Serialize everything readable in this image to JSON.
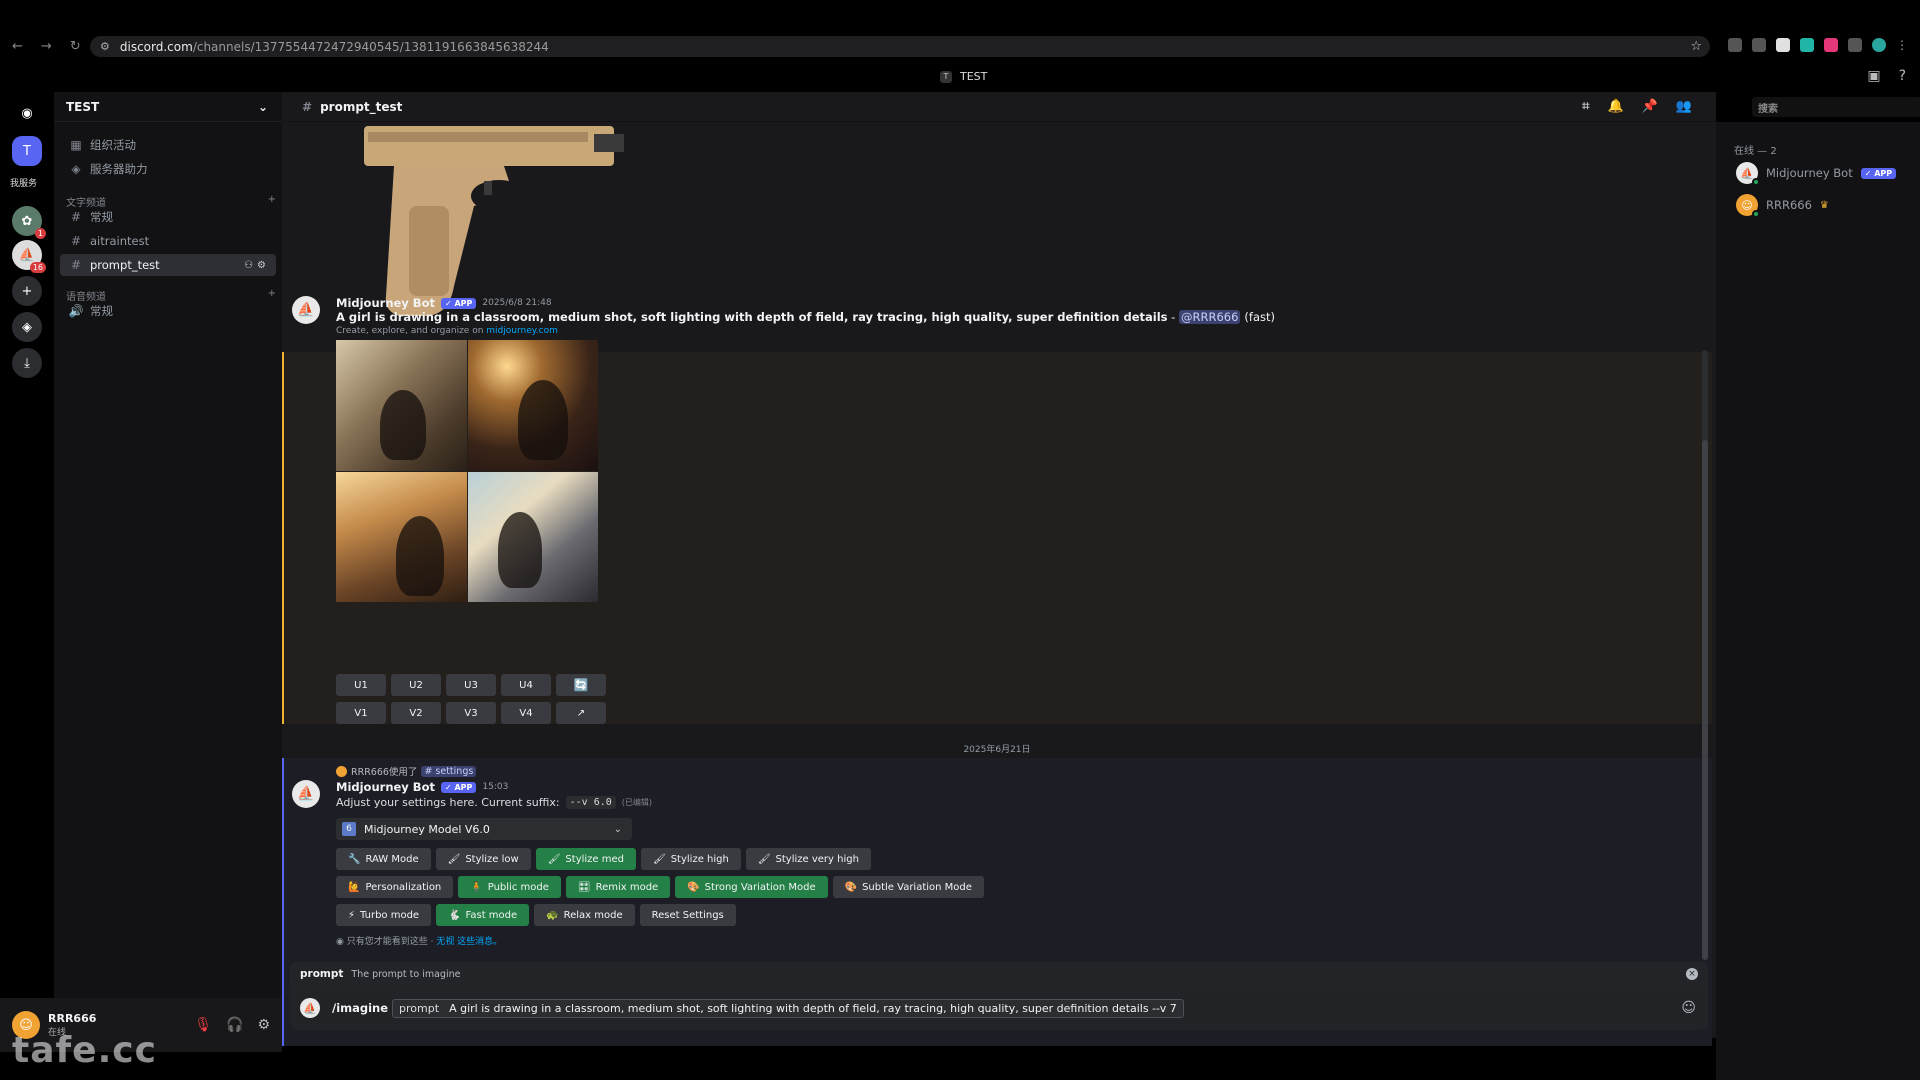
{
  "browser": {
    "url_host": "discord.com",
    "url_path": "/channels/1377554472472940545/1381191663845638244"
  },
  "window": {
    "guild_title": "TEST"
  },
  "rail": {
    "server_initial": "T",
    "label": "我服务",
    "badges": [
      "1",
      "16"
    ]
  },
  "guild": {
    "name": "TEST",
    "top_items": [
      {
        "label": "组织活动",
        "icon": "calendar-icon"
      },
      {
        "label": "服务器助力",
        "icon": "boost-icon"
      }
    ],
    "text_category": "文字频道",
    "text_channels": [
      "常规",
      "aitraintest",
      "prompt_test"
    ],
    "voice_category": "语音频道",
    "voice_channels": [
      "常规"
    ]
  },
  "user": {
    "name": "RRR666",
    "status": "在线"
  },
  "watermark": "tafe.cc",
  "chat": {
    "channel": "prompt_test",
    "search_placeholder": "搜索",
    "msg1": {
      "author": "Midjourney Bot",
      "badge": "✓ APP",
      "time": "2025/6/8 21:48",
      "prompt": "A girl is drawing in a classroom, medium shot, soft lighting with depth of field, ray tracing, high quality, super definition details",
      "dash": " - ",
      "mention": "@RRR666",
      "speed": "(fast)",
      "sub_text": "Create, explore, and organize on ",
      "sub_link": "midjourney.com",
      "buttons_row1": [
        "U1",
        "U2",
        "U3",
        "U4"
      ],
      "buttons_row2": [
        "V1",
        "V2",
        "V3",
        "V4"
      ]
    },
    "date_divider": "2025年6月21日",
    "msg2": {
      "reply_user": "RRR666使用了",
      "reply_cmd": "# settings",
      "author": "Midjourney Bot",
      "badge": "✓ APP",
      "time": "15:03",
      "text": "Adjust your settings here. Current suffix:",
      "suffix": "--v 6.0",
      "edited": "(已编辑)",
      "select_value": "Midjourney Model V6.0",
      "select_icon_text": "6",
      "row1": [
        {
          "label": "RAW Mode",
          "on": false,
          "icon": "🔧"
        },
        {
          "label": "Stylize low",
          "on": false,
          "icon": "🖌"
        },
        {
          "label": "Stylize med",
          "on": true,
          "icon": "🖌"
        },
        {
          "label": "Stylize high",
          "on": false,
          "icon": "🖌"
        },
        {
          "label": "Stylize very high",
          "on": false,
          "icon": "🖌"
        }
      ],
      "row2": [
        {
          "label": "Personalization",
          "on": false,
          "icon": "🙋"
        },
        {
          "label": "Public mode",
          "on": true,
          "icon": "🧍"
        },
        {
          "label": "Remix mode",
          "on": true,
          "icon": "🎛"
        },
        {
          "label": "Strong Variation Mode",
          "on": true,
          "icon": "🎨"
        },
        {
          "label": "Subtle Variation Mode",
          "on": false,
          "icon": "🎨"
        }
      ],
      "row3": [
        {
          "label": "Turbo mode",
          "on": false,
          "icon": "⚡"
        },
        {
          "label": "Fast mode",
          "on": true,
          "icon": "🐇"
        },
        {
          "label": "Relax mode",
          "on": false,
          "icon": "🐢"
        },
        {
          "label": "Reset Settings",
          "on": false,
          "icon": ""
        }
      ],
      "only_you": "只有您才能看到这些 · ",
      "dismiss": "无视 这些消息。"
    },
    "command": {
      "option": "prompt",
      "option_desc": "The prompt to imagine",
      "slash": "/imagine",
      "param_key": "prompt",
      "param_value": "A girl is drawing in a classroom, medium shot, soft lighting with depth of field, ray tracing, high quality, super definition details --v 7"
    }
  },
  "members": {
    "group": "在线 — 2",
    "list": [
      {
        "name": "Midjourney Bot",
        "badge": "✓ APP"
      },
      {
        "name": "RRR666"
      }
    ]
  },
  "colors": {
    "accent": "#5865f2",
    "success": "#248046",
    "highlight": "#f0b232"
  }
}
